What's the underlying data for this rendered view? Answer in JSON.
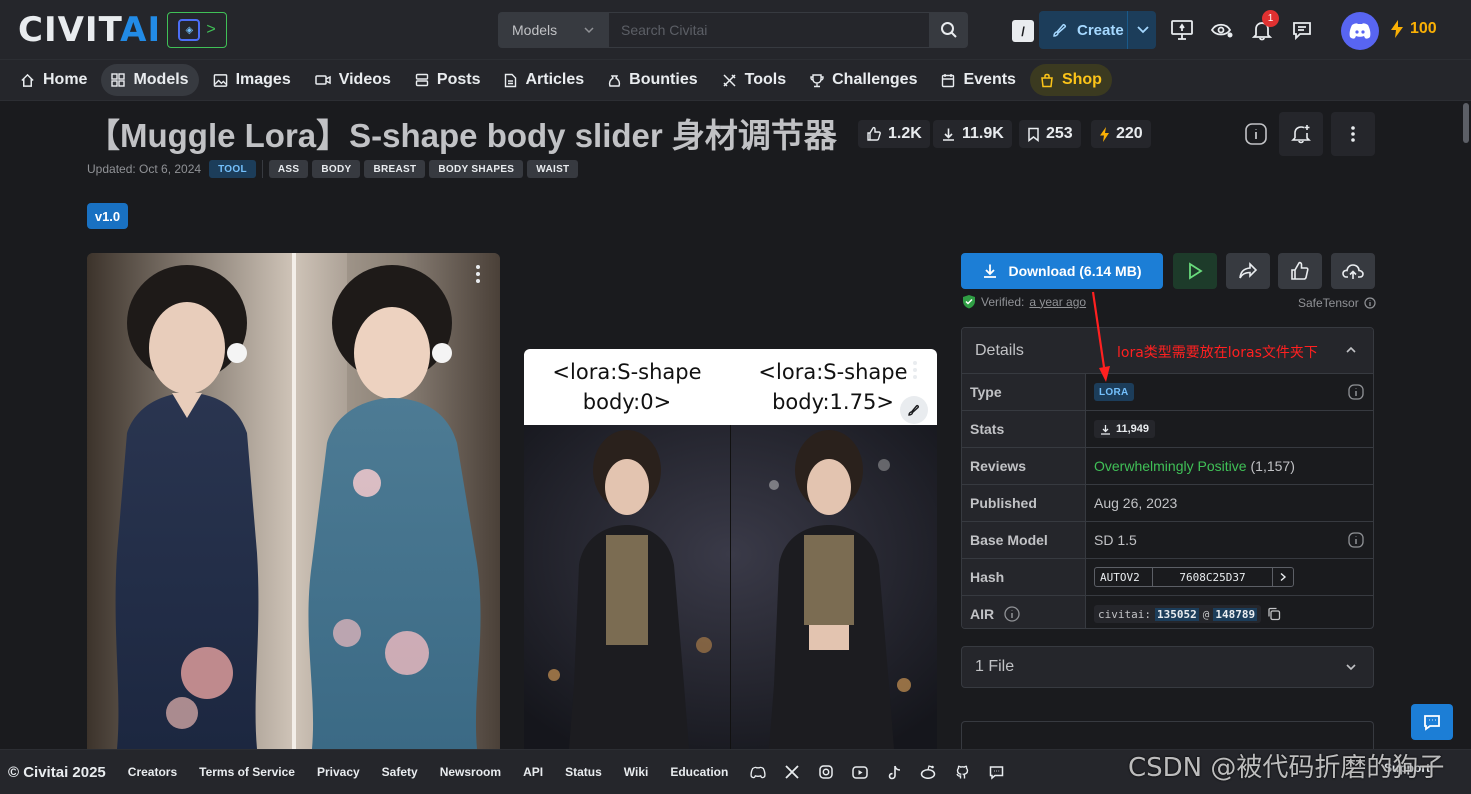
{
  "header": {
    "logo_main": "CIVIT",
    "logo_accent": "AI",
    "logo_badge_arrow": ">",
    "search_category": "Models",
    "search_placeholder": "Search Civitai",
    "search_shortcut": "/",
    "create_label": "Create",
    "notification_count": "1",
    "buzz_amount": "100"
  },
  "nav": {
    "items": [
      {
        "label": "Home",
        "icon": "home-icon"
      },
      {
        "label": "Models",
        "icon": "grid-icon"
      },
      {
        "label": "Images",
        "icon": "image-icon"
      },
      {
        "label": "Videos",
        "icon": "video-icon"
      },
      {
        "label": "Posts",
        "icon": "posts-icon"
      },
      {
        "label": "Articles",
        "icon": "article-icon"
      },
      {
        "label": "Bounties",
        "icon": "bag-icon"
      },
      {
        "label": "Tools",
        "icon": "tools-icon"
      },
      {
        "label": "Challenges",
        "icon": "trophy-icon"
      },
      {
        "label": "Events",
        "icon": "calendar-icon"
      },
      {
        "label": "Shop",
        "icon": "shop-icon"
      }
    ]
  },
  "model": {
    "title": "【Muggle Lora】S-shape body slider 身材调节器",
    "likes": "1.2K",
    "downloads": "11.9K",
    "bookmarks": "253",
    "buzz": "220",
    "updated": "Updated: Oct 6, 2024",
    "tags": [
      "TOOL",
      "ASS",
      "BODY",
      "BREAST",
      "BODY SHAPES",
      "WAIST"
    ],
    "version": "v1.0"
  },
  "gallery": {
    "caption_left": "<lora:S-shape body:0>",
    "caption_right": "<lora:S-shape body:1.75>"
  },
  "actions": {
    "download_label": "Download (6.14 MB)",
    "verified_label": "Verified:",
    "verified_time": "a year ago",
    "safetensor_label": "SafeTensor"
  },
  "details": {
    "heading": "Details",
    "rows": {
      "type_key": "Type",
      "type_value": "LORA",
      "stats_key": "Stats",
      "stats_value": "11,949",
      "reviews_key": "Reviews",
      "reviews_value": "Overwhelmingly Positive",
      "reviews_count": "(1,157)",
      "published_key": "Published",
      "published_value": "Aug 26, 2023",
      "base_key": "Base Model",
      "base_value": "SD 1.5",
      "hash_key": "Hash",
      "hash_algo": "AUTOV2",
      "hash_value": "7608C25D37",
      "air_key": "AIR",
      "air_prefix": "civitai:",
      "air_model": "135052",
      "air_at": "@",
      "air_version": "148789"
    }
  },
  "annotation": "lora类型需要放在loras文件夹下",
  "files_label": "1 File",
  "footer": {
    "copyright": "© Civitai 2025",
    "links": [
      "Creators",
      "Terms of Service",
      "Privacy",
      "Safety",
      "Newsroom",
      "API",
      "Status",
      "Wiki",
      "Education"
    ],
    "support": "Support"
  },
  "watermark": "CSDN @被代码折磨的狗子",
  "colors": {
    "accent": "#1c7ed6",
    "background": "#1a1b1e",
    "surface": "#25262b",
    "positive": "#40c057",
    "buzz": "#fab005",
    "annotation": "#ff2020"
  }
}
